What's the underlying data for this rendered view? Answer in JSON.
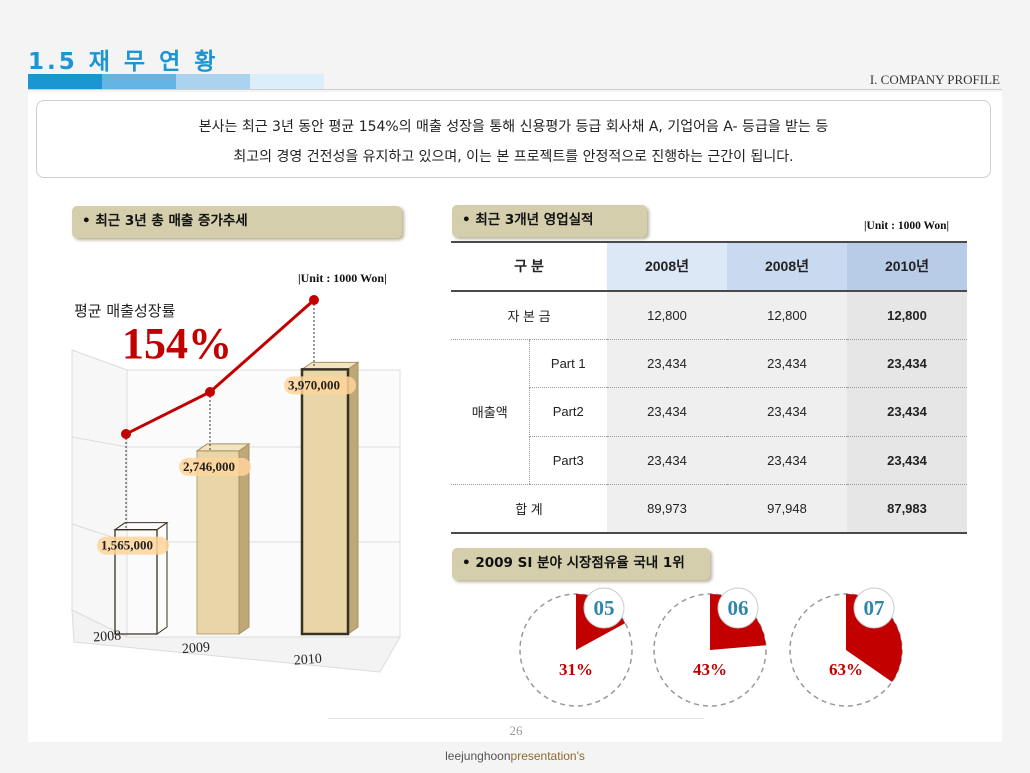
{
  "header": {
    "title": "1.5 재 무 연 황",
    "section": "I. COMPANY PROFILE"
  },
  "intro": {
    "line1": "본사는 최근 3년 동안 평균 154%의 매출 성장을 통해 신용평가 등급 회사채 A, 기업어음 A- 등급을 받는 등",
    "line2": "최고의 경영 건전성을 유지하고 있으며, 이는 본 프로젝트를 안정적으로 진행하는 근간이 됩니다."
  },
  "left_panel": {
    "pill": "• 최근 3년 총 매출 증가추세",
    "unit": "|Unit : 1000 Won|",
    "avg_label": "평균 매출성장률",
    "avg_value": "154%"
  },
  "chart_data": {
    "type": "bar",
    "categories": [
      "2008",
      "2009",
      "2010"
    ],
    "values": [
      1565000,
      2746000,
      3970000
    ],
    "value_labels": [
      "1,565,000",
      "2,746,000",
      "3,970,000"
    ],
    "title": "",
    "ylabel": "",
    "ylim": [
      0,
      4500000
    ],
    "colors": {
      "bar": "#e9d6a8",
      "line": "#c20000"
    }
  },
  "right_panel": {
    "pill": "• 최근 3개년 영업실적",
    "unit": "|Unit : 1000 Won|",
    "table": {
      "headers": [
        "구 분",
        "2008년",
        "2008년",
        "2010년"
      ],
      "capital_label": "자 본 금",
      "capital": [
        "12,800",
        "12,800",
        "12,800"
      ],
      "sales_label": "매출액",
      "parts": [
        {
          "label": "Part 1",
          "values": [
            "23,434",
            "23,434",
            "23,434"
          ]
        },
        {
          "label": "Part2",
          "values": [
            "23,434",
            "23,434",
            "23,434"
          ]
        },
        {
          "label": "Part3",
          "values": [
            "23,434",
            "23,434",
            "23,434"
          ]
        }
      ],
      "total_label": "합 계",
      "total": [
        "89,973",
        "97,948",
        "87,983"
      ]
    }
  },
  "market": {
    "pill": "• 2009 SI 분야 시장점유율 국내 1위",
    "items": [
      {
        "year": "05",
        "percent": "31%",
        "fraction": 0.31
      },
      {
        "year": "06",
        "percent": "43%",
        "fraction": 0.43
      },
      {
        "year": "07",
        "percent": "63%",
        "fraction": 0.63
      }
    ]
  },
  "footer": {
    "page": "26",
    "credit_a": "leejunghoon",
    "credit_b": "presentation's"
  }
}
